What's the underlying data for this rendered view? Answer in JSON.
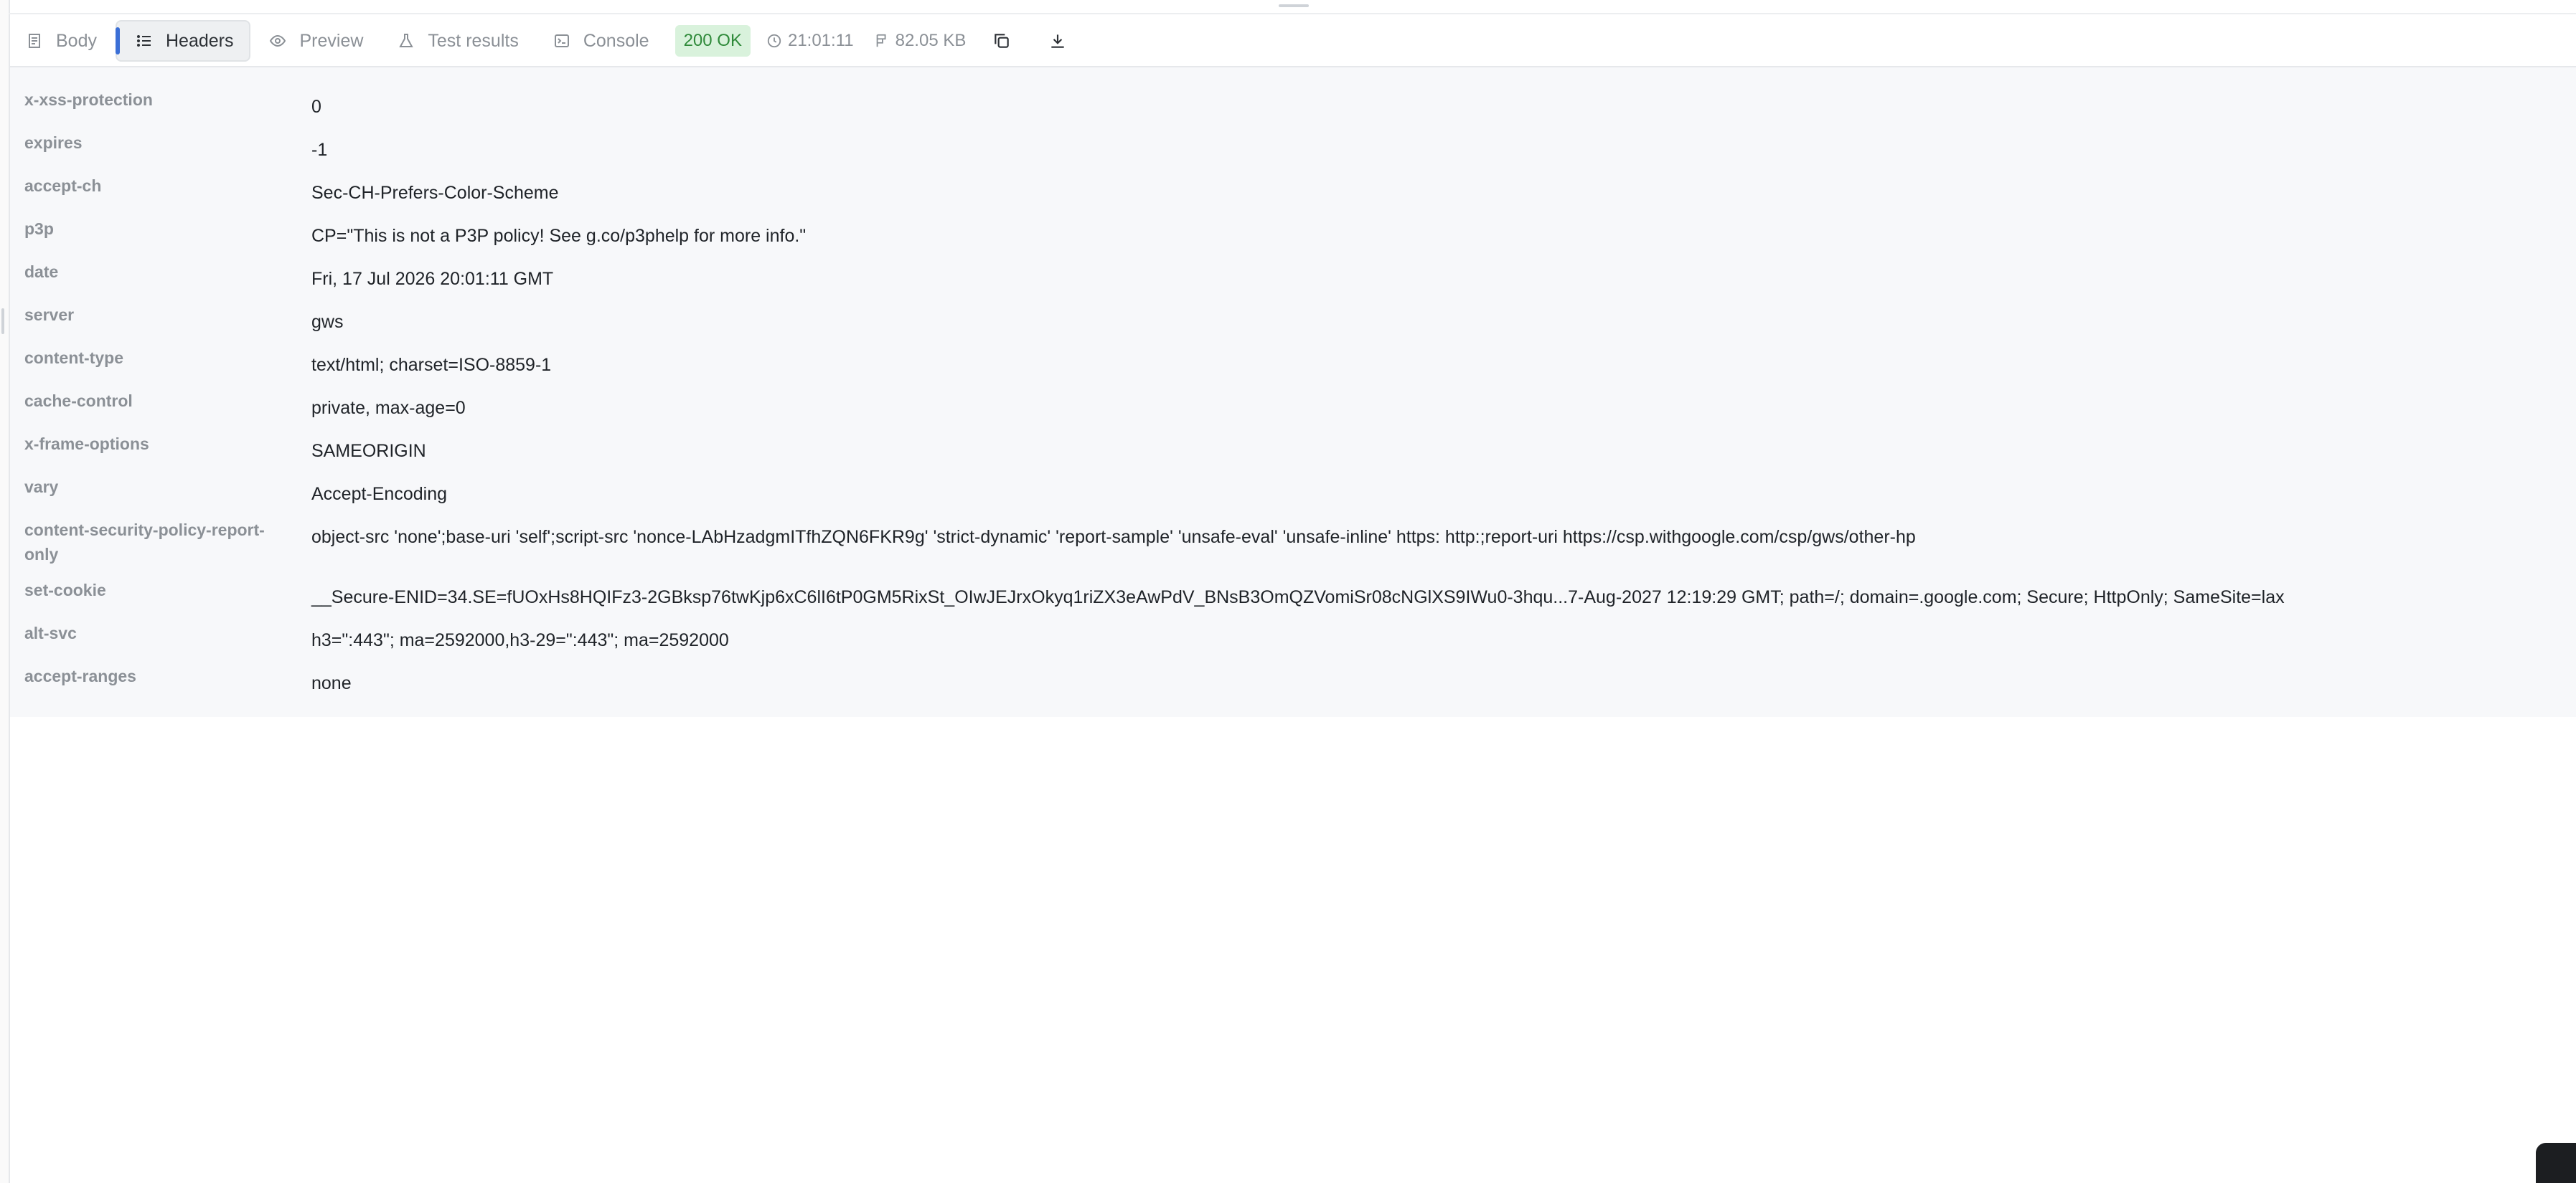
{
  "toolbar": {
    "tabs": [
      {
        "label": "Body",
        "icon": "body-icon"
      },
      {
        "label": "Headers",
        "icon": "list-icon",
        "active": true
      },
      {
        "label": "Preview",
        "icon": "eye-icon"
      },
      {
        "label": "Test results",
        "icon": "flask-icon"
      },
      {
        "label": "Console",
        "icon": "terminal-icon"
      }
    ],
    "status": "200 OK",
    "time": "21:01:11",
    "size": "82.05 KB"
  },
  "colors": {
    "accent": "#3b6fd6",
    "status_bg": "#d9f2dc",
    "status_fg": "#2f8a3a"
  },
  "headers": [
    {
      "key": "x-xss-protection",
      "value": "0"
    },
    {
      "key": "expires",
      "value": "-1"
    },
    {
      "key": "accept-ch",
      "value": "Sec-CH-Prefers-Color-Scheme"
    },
    {
      "key": "p3p",
      "value": "CP=\"This is not a P3P policy! See g.co/p3phelp for more info.\""
    },
    {
      "key": "date",
      "value": "Fri, 17 Jul 2026 20:01:11 GMT"
    },
    {
      "key": "server",
      "value": "gws"
    },
    {
      "key": "content-type",
      "value": "text/html; charset=ISO-8859-1"
    },
    {
      "key": "cache-control",
      "value": "private, max-age=0"
    },
    {
      "key": "x-frame-options",
      "value": "SAMEORIGIN"
    },
    {
      "key": "vary",
      "value": "Accept-Encoding"
    },
    {
      "key": "content-security-policy-report-only",
      "value": "object-src 'none';base-uri 'self';script-src 'nonce-LAbHzadgmITfhZQN6FKR9g' 'strict-dynamic' 'report-sample' 'unsafe-eval' 'unsafe-inline' https: http:;report-uri https://csp.withgoogle.com/csp/gws/other-hp"
    },
    {
      "key": "set-cookie",
      "value": "__Secure-ENID=34.SE=fUOxHs8HQIFz3-2GBksp76twKjp6xC6lI6tP0GM5RixSt_OIwJEJrxOkyq1riZX3eAwPdV_BNsB3OmQZVomiSr08cNGlXS9IWu0-3hqu...7-Aug-2027 12:19:29 GMT; path=/; domain=.google.com; Secure; HttpOnly; SameSite=lax"
    },
    {
      "key": "alt-svc",
      "value": "h3=\":443\"; ma=2592000,h3-29=\":443\"; ma=2592000"
    },
    {
      "key": "accept-ranges",
      "value": "none"
    }
  ]
}
